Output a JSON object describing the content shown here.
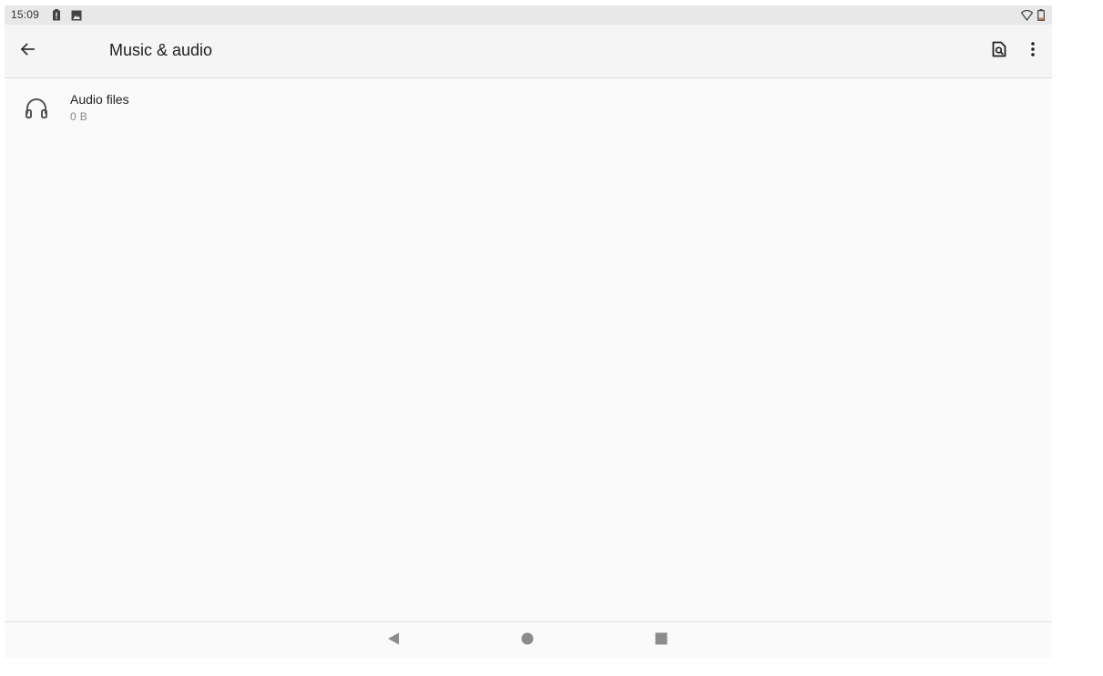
{
  "status_bar": {
    "time": "15:09",
    "icons": [
      "battery-alert-icon",
      "image-icon",
      "wifi-icon",
      "battery-icon"
    ]
  },
  "app_bar": {
    "title": "Music & audio",
    "back_icon": "arrow-back-icon",
    "search_icon": "file-search-icon",
    "menu_icon": "more-vert-icon"
  },
  "list": {
    "items": [
      {
        "icon": "headphones-icon",
        "title": "Audio files",
        "subtitle": "0 B"
      }
    ]
  },
  "nav_bar": {
    "buttons": [
      "back-triangle-icon",
      "home-circle-icon",
      "recents-square-icon"
    ]
  },
  "colors": {
    "background": "#fafafa",
    "status_bar": "#e8e8e8",
    "app_bar": "#f5f5f5",
    "text_primary": "#202020",
    "text_secondary": "#8a8a8a",
    "icon": "#555555"
  }
}
